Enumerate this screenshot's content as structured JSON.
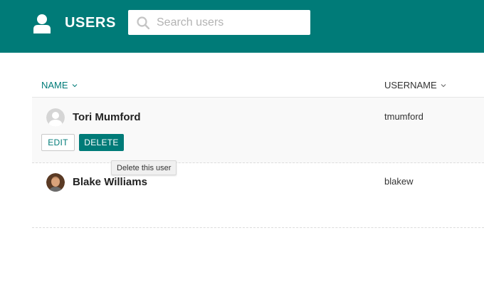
{
  "header": {
    "title": "USERS",
    "icon": "user-icon",
    "background": "#007b78"
  },
  "search": {
    "placeholder": "Search users",
    "value": "",
    "icon": "search-icon"
  },
  "table": {
    "columns": [
      {
        "label": "NAME",
        "sortable": true,
        "active": true
      },
      {
        "label": "USERNAME",
        "sortable": true,
        "active": false
      }
    ],
    "rows": [
      {
        "name": "Tori Mumford",
        "username": "tmumford",
        "avatar": "default-avatar-icon",
        "hovered": true
      },
      {
        "name": "Blake Williams",
        "username": "blakew",
        "avatar": "user-photo",
        "hovered": false
      }
    ],
    "row_actions": {
      "edit_label": "EDIT",
      "delete_label": "DELETE"
    }
  },
  "tooltip": {
    "text": "Delete this user"
  },
  "colors": {
    "accent": "#007b78",
    "row_hover": "#f9f9f9",
    "divider": "#dcdcdc"
  }
}
